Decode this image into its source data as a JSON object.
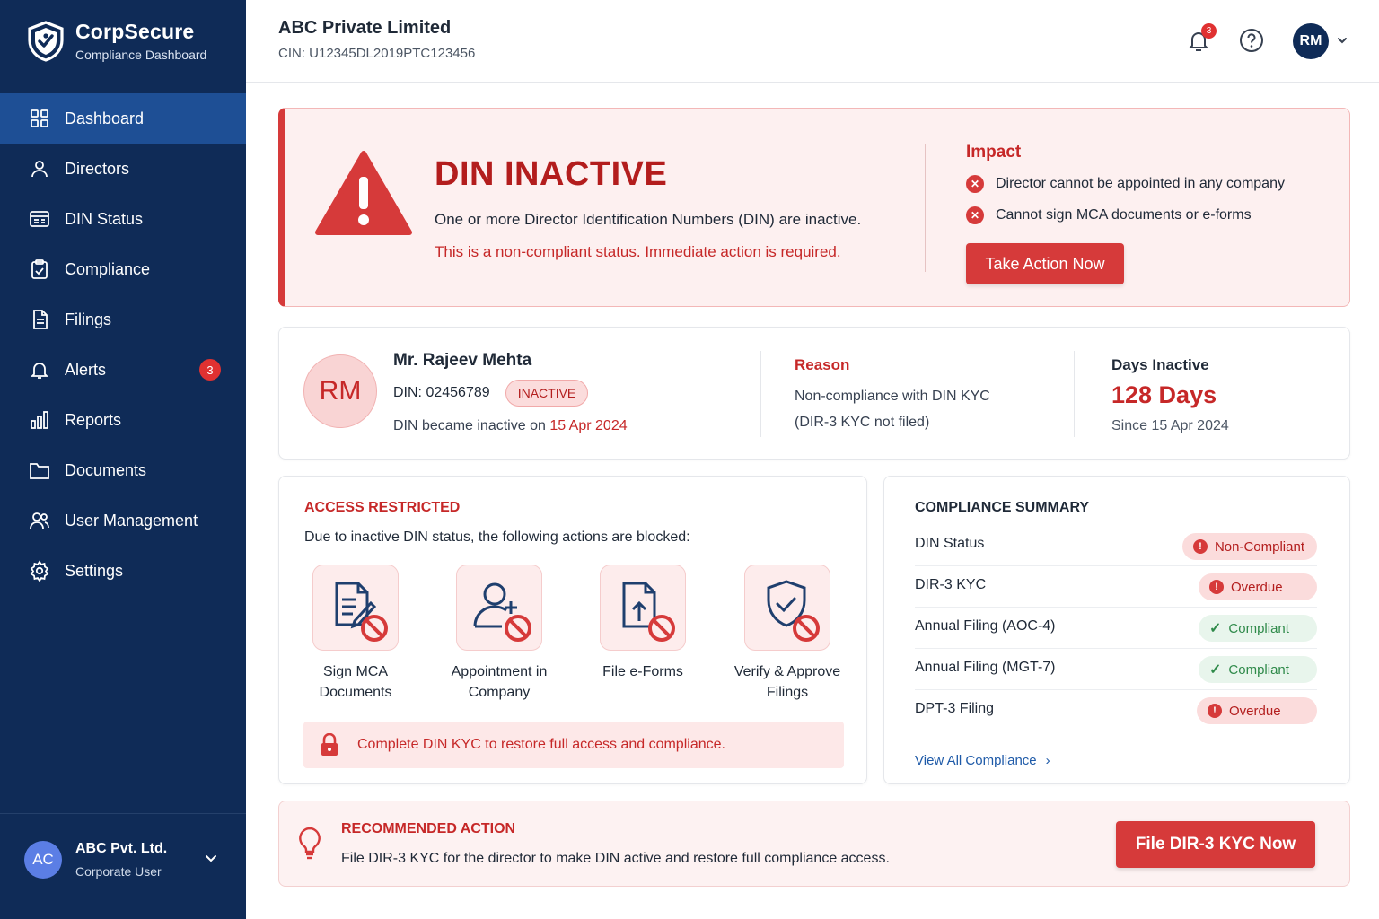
{
  "app": {
    "name": "CorpSecure",
    "subtitle": "Compliance Dashboard"
  },
  "sidebar": {
    "items": [
      {
        "label": "Dashboard",
        "icon": "grid-icon",
        "active": true
      },
      {
        "label": "Directors",
        "icon": "user-icon"
      },
      {
        "label": "DIN Status",
        "icon": "id-card-icon"
      },
      {
        "label": "Compliance",
        "icon": "clipboard-check-icon"
      },
      {
        "label": "Filings",
        "icon": "document-icon"
      },
      {
        "label": "Alerts",
        "icon": "bell-icon",
        "badge": "3"
      },
      {
        "label": "Reports",
        "icon": "bar-chart-icon"
      },
      {
        "label": "Documents",
        "icon": "folder-icon"
      },
      {
        "label": "User Management",
        "icon": "users-icon"
      },
      {
        "label": "Settings",
        "icon": "gear-icon"
      }
    ],
    "footer": {
      "initials": "AC",
      "name": "ABC Pvt. Ltd.",
      "role": "Corporate User"
    }
  },
  "header": {
    "company": "ABC Private Limited",
    "cin": "CIN: U12345DL2019PTC123456",
    "notifications": "3",
    "user_initials": "RM"
  },
  "alert": {
    "title": "DIN INACTIVE",
    "description": "One or more Director Identification Numbers (DIN) are inactive.",
    "warning": "This is a non-compliant status. Immediate action is required.",
    "impact_title": "Impact",
    "impacts": [
      "Director cannot be appointed in any company",
      "Cannot sign MCA documents or e-forms"
    ],
    "action_label": "Take Action Now"
  },
  "director": {
    "initials": "RM",
    "name": "Mr. Rajeev Mehta",
    "din": "DIN: 02456789",
    "status": "INACTIVE",
    "since_prefix": "DIN became inactive on ",
    "since_date": "15 Apr 2024",
    "reason_title": "Reason",
    "reason_line1": "Non-compliance with DIN KYC",
    "reason_line2": "(DIR-3 KYC not filed)",
    "days_title": "Days Inactive",
    "days_value": "128 Days",
    "days_since": "Since 15 Apr 2024"
  },
  "access": {
    "title": "ACCESS RESTRICTED",
    "subtitle": "Due to inactive DIN status, the following actions are blocked:",
    "items": [
      {
        "line1": "Sign MCA",
        "line2": "Documents",
        "icon": "sign-document-blocked-icon"
      },
      {
        "line1": "Appointment in",
        "line2": "Company",
        "icon": "add-user-blocked-icon"
      },
      {
        "line1": "File e-Forms",
        "line2": "",
        "icon": "upload-file-blocked-icon"
      },
      {
        "line1": "Verify & Approve",
        "line2": "Filings",
        "icon": "shield-check-blocked-icon"
      }
    ],
    "note": "Complete DIN KYC to restore full access and compliance."
  },
  "compliance": {
    "title": "COMPLIANCE SUMMARY",
    "rows": [
      {
        "label": "DIN Status",
        "status": "Non-Compliant",
        "state": "bad"
      },
      {
        "label": "DIR-3 KYC",
        "status": "Overdue",
        "state": "bad"
      },
      {
        "label": "Annual Filing (AOC-4)",
        "status": "Compliant",
        "state": "ok"
      },
      {
        "label": "Annual Filing (MGT-7)",
        "status": "Compliant",
        "state": "ok"
      },
      {
        "label": "DPT-3 Filing",
        "status": "Overdue",
        "state": "bad"
      }
    ],
    "link": "View All Compliance"
  },
  "recommended": {
    "title": "RECOMMENDED ACTION",
    "description": "File DIR-3 KYC for the director to make DIN active and restore full compliance access.",
    "button": "File DIR-3 KYC Now"
  },
  "colors": {
    "sidebar": "#0f2b57",
    "active": "#1e4f95",
    "danger": "#d63a3a",
    "success": "#2f8a4a"
  }
}
